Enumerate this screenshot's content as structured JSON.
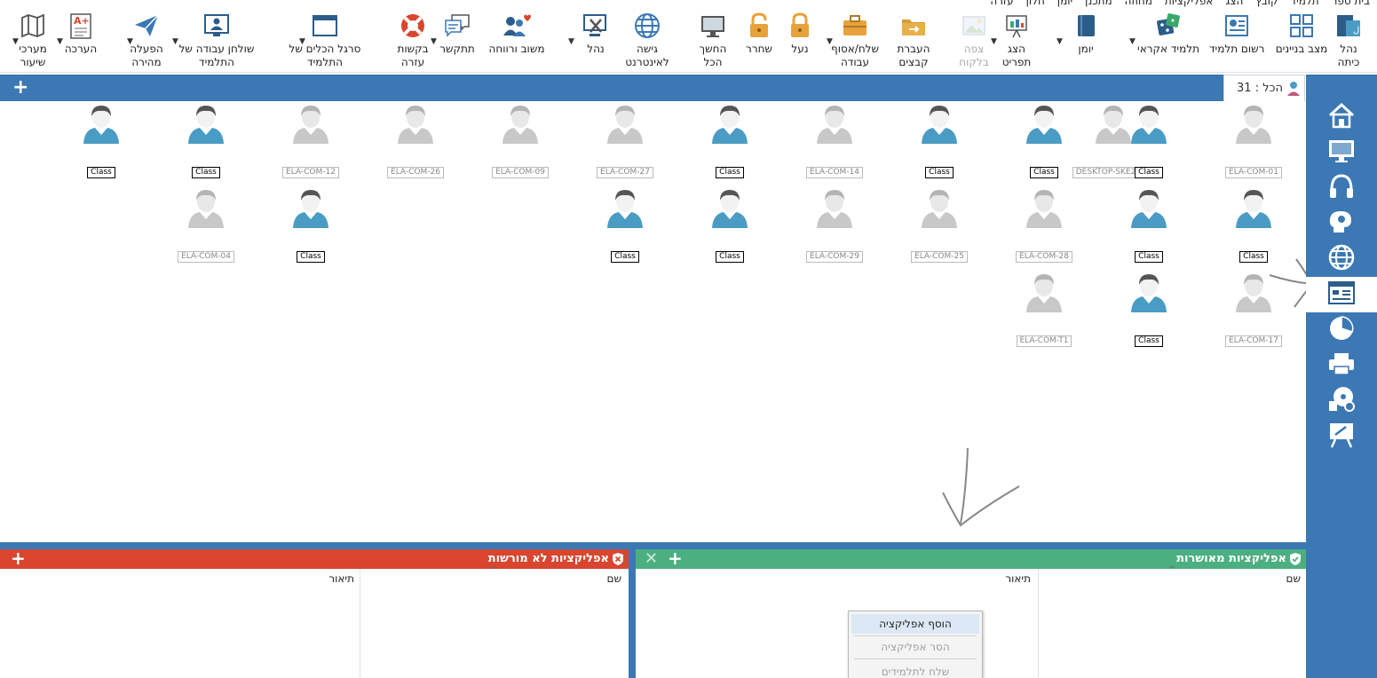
{
  "menubar": [
    "בית ספר",
    "תלמיד",
    "קובץ",
    "הצג",
    "אפליקציות",
    "מחוזה",
    "מתכנן",
    "יומן",
    "חלון",
    "עזרה"
  ],
  "toolbar": {
    "items": [
      {
        "id": "manage-class",
        "label": [
          "נהל",
          "כיתה"
        ],
        "icon": "class-manage-icon"
      },
      {
        "id": "building-status",
        "label": [
          "מצב בניינים"
        ],
        "icon": "grid-view-icon"
      },
      {
        "id": "register-student",
        "label": [
          "רשום תלמיד"
        ],
        "icon": "student-card-icon"
      },
      {
        "id": "random-student",
        "label": [
          "תלמיד אקראי"
        ],
        "icon": "dice-icon"
      },
      {
        "id": "journal",
        "label": [
          "יומן"
        ],
        "icon": "book-icon"
      },
      {
        "id": "show-item",
        "label": [
          "הצג",
          "תפריט"
        ],
        "icon": "present-icon"
      },
      {
        "id": "view-thumbnail",
        "label": [
          "צפה",
          "בלקוח"
        ],
        "icon": "thumbnail-view-icon",
        "disabled": true
      },
      {
        "id": "file-transfer",
        "label": [
          "העברת",
          "קבצים"
        ],
        "icon": "folder-transfer-icon"
      },
      {
        "id": "send-collect",
        "label": [
          "שלח/אסוף",
          "עבודה"
        ],
        "icon": "briefcase-icon"
      },
      {
        "id": "lock",
        "label": [
          "נעל"
        ],
        "icon": "lock-icon"
      },
      {
        "id": "unlock",
        "label": [
          "שחרר"
        ],
        "icon": "unlock-icon"
      },
      {
        "id": "blank-all",
        "label": [
          "החשך",
          "הכל"
        ],
        "icon": "monitor-icon"
      },
      {
        "id": "internet-access",
        "label": [
          "גישה",
          "לאינטרנט"
        ],
        "icon": "globe-icon"
      },
      {
        "id": "manage",
        "label": [
          "נהל"
        ],
        "icon": "remote-control-icon"
      },
      {
        "id": "feedback",
        "label": [
          "משוב ורווחה"
        ],
        "icon": "users-heart-icon"
      },
      {
        "id": "chat",
        "label": [
          "תתקשר"
        ],
        "icon": "chat-icon"
      },
      {
        "id": "help-requests",
        "label": [
          "בקשות",
          "עזרה"
        ],
        "icon": "lifebuoy-icon"
      },
      {
        "id": "student-toolbar",
        "label": [
          "סרגל הכלים של",
          "התלמיד"
        ],
        "icon": "window-toolbar-icon"
      },
      {
        "id": "student-desktop",
        "label": [
          "שולחן עבודה של",
          "התלמיד"
        ],
        "icon": "desktop-user-icon"
      },
      {
        "id": "quick-launch",
        "label": [
          "הפעלה",
          "מהירה"
        ],
        "icon": "paper-plane-icon"
      },
      {
        "id": "assessment",
        "label": [
          "הערכה"
        ],
        "icon": "grade-sheet-icon"
      },
      {
        "id": "lesson-plans",
        "label": [
          "מערכי",
          "שיעור"
        ],
        "icon": "map-icon"
      }
    ]
  },
  "group_tab": {
    "label": "הכל",
    "count": "31"
  },
  "students": [
    {
      "name": "ELA-COM-01",
      "online": false
    },
    {
      "name": "DESKTOP-SKE2S9P",
      "online": false
    },
    {
      "name": "Class",
      "online": true
    },
    {
      "name": "Class",
      "online": true
    },
    {
      "name": "Class",
      "online": true
    },
    {
      "name": "ELA-COM-14",
      "online": false
    },
    {
      "name": "Class",
      "online": true
    },
    {
      "name": "ELA-COM-27",
      "online": false
    },
    {
      "name": "ELA-COM-09",
      "online": false
    },
    {
      "name": "ELA-COM-26",
      "online": false
    },
    {
      "name": "ELA-COM-12",
      "online": false
    },
    {
      "name": "Class",
      "online": true
    },
    {
      "name": "Class",
      "online": true
    },
    {
      "name": "Class",
      "online": true
    },
    {
      "name": "Class",
      "online": true
    },
    {
      "name": "ELA-COM-28",
      "online": false
    },
    {
      "name": "ELA-COM-25",
      "online": false
    },
    {
      "name": "ELA-COM-29",
      "online": false
    },
    {
      "name": "Class",
      "online": true
    },
    {
      "name": "Class",
      "online": true
    },
    {
      "name": "Class",
      "online": true
    },
    {
      "name": "ELA-COM-04",
      "online": false
    },
    {
      "name": "ELA-COM-17",
      "online": false
    },
    {
      "name": "Class",
      "online": true
    },
    {
      "name": "ELA-COM-T1",
      "online": false
    }
  ],
  "sidebar": [
    "home-icon",
    "monitor-icon",
    "headphones-icon",
    "brain-icon",
    "globe-icon",
    "window-apps-icon",
    "pie-chart-icon",
    "printer-icon",
    "media-icon",
    "whiteboard-icon"
  ],
  "panels": {
    "approved": {
      "title": "אפליקציות מאושרות",
      "col_name": "שם",
      "col_desc": "תיאור",
      "color": "#4caf81"
    },
    "blocked": {
      "title": "אפליקציות לא מורשות",
      "col_name": "שם",
      "col_desc": "תיאור",
      "color": "#d9452f"
    }
  },
  "context_menu": {
    "items": [
      {
        "label": "הוסף אפליקציה",
        "enabled": true,
        "highlighted": true
      },
      {
        "label": "הסר אפליקציה",
        "enabled": false
      },
      {
        "label": "שלח לתלמידים",
        "enabled": false
      }
    ]
  },
  "colors": {
    "blue": "#3c78b4",
    "student_online": "#4a9cc4",
    "student_off": "#c8c8c8"
  }
}
